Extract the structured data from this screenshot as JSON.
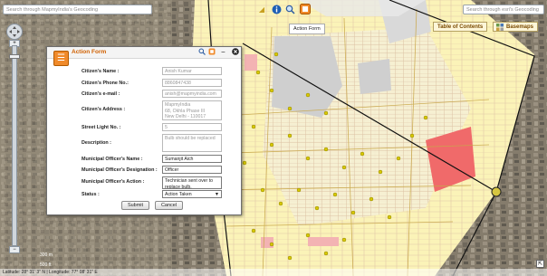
{
  "search": {
    "left_placeholder": "Search through MapmyIndia's Geocoding",
    "right_placeholder": "Search through esri's Geocoding"
  },
  "toolbar": {
    "icons": [
      "measure-icon",
      "info-icon",
      "search-icon",
      "form-icon"
    ],
    "tooltip": "Action Form"
  },
  "panels": {
    "table_of_contents": "Table of Contents",
    "basemaps": "Basemaps"
  },
  "zoom": {
    "plus": "+",
    "minus": "−"
  },
  "form": {
    "title": "Action Form",
    "fields": [
      {
        "label": "Citizen's Name :",
        "value": "Anish Kumar"
      },
      {
        "label": "Citizen's Phone No.:",
        "value": "8860847438"
      },
      {
        "label": "Citizen's e-mail :",
        "value": "anish@mapmyindia.com"
      },
      {
        "label": "Citizen's Address :",
        "value": "MapmyIndia\n68, Okhla Phase III\nNew Delhi - 110017"
      },
      {
        "label": "Street Light No. :",
        "value": "5"
      },
      {
        "label": "Description :",
        "value": "Bulb should be replaced"
      },
      {
        "label": "Municipal Officer's Name :",
        "value": "Sumanjit Aich"
      },
      {
        "label": "Municipal Officer's Designation :",
        "value": "Officer"
      },
      {
        "label": "Municipal Officer's Action :",
        "value": "Technician sent over to replace bulb."
      },
      {
        "label": "Status :",
        "value": "Action Taken"
      }
    ],
    "submit": "Submit",
    "cancel": "Cancel"
  },
  "status_bar": {
    "text": "Latitude: 28° 31' 3\" N | Longitude: 77° 08' 31\" E",
    "scale_m": "300 m",
    "scale_ft": "500 ft"
  },
  "colors": {
    "form_title": "#d06000",
    "accent_orange": "#f08a2a",
    "parcel_yellow": "#fbf3b8",
    "highlight_red": "#f06060"
  }
}
